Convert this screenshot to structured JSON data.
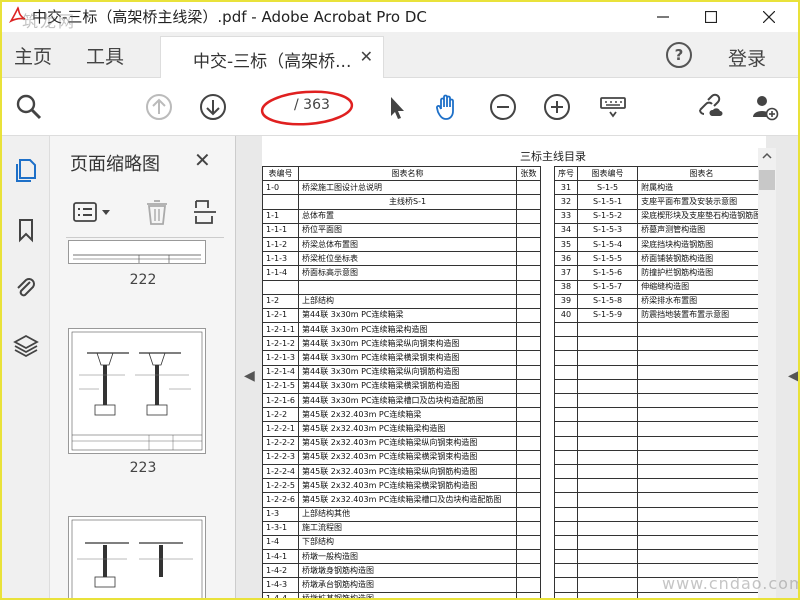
{
  "window": {
    "title": "中交-三标（高架桥主线梁）.pdf - Adobe Acrobat Pro DC",
    "watermark_top": "筑龙网",
    "watermark_bottom": "www.cndao.com",
    "accent_color": "#e9e23a"
  },
  "tabs": {
    "home": "主页",
    "tools": "工具",
    "document": "中交-三标（高架桥...",
    "login": "登录"
  },
  "toolbar": {
    "page_current": "",
    "page_total": "/ 363"
  },
  "thumbnails": {
    "panel_title": "页面缩略图",
    "pages": [
      "222",
      "223"
    ]
  },
  "document": {
    "heading": "三标主线目录",
    "left_table": {
      "headers": [
        "表编号",
        "图表名称",
        "张数"
      ],
      "rows": [
        [
          "1-0",
          "桥梁施工图设计总说明",
          ""
        ],
        [
          "",
          "主线桥S-1",
          ""
        ],
        [
          "1-1",
          "总体布置",
          ""
        ],
        [
          "1-1-1",
          "桥位平面图",
          ""
        ],
        [
          "1-1-2",
          "桥梁总体布置图",
          ""
        ],
        [
          "1-1-3",
          "桥梁桩位坐标表",
          ""
        ],
        [
          "1-1-4",
          "桥面标高示意图",
          ""
        ],
        [
          "",
          "",
          ""
        ],
        [
          "1-2",
          "上部结构",
          ""
        ],
        [
          "1-2-1",
          "第44联 3x30m PC连续箱梁",
          ""
        ],
        [
          "1-2-1-1",
          "第44联 3x30m PC连续箱梁构造图",
          ""
        ],
        [
          "1-2-1-2",
          "第44联 3x30m PC连续箱梁纵向钢束构造图",
          ""
        ],
        [
          "1-2-1-3",
          "第44联 3x30m PC连续箱梁横梁钢束构造图",
          ""
        ],
        [
          "1-2-1-4",
          "第44联 3x30m PC连续箱梁纵向钢筋构造图",
          ""
        ],
        [
          "1-2-1-5",
          "第44联 3x30m PC连续箱梁横梁钢筋构造图",
          ""
        ],
        [
          "1-2-1-6",
          "第44联 3x30m PC连续箱梁槽口及齿块构造配筋图",
          ""
        ],
        [
          "1-2-2",
          "第45联 2x32.403m PC连续箱梁",
          ""
        ],
        [
          "1-2-2-1",
          "第45联 2x32.403m PC连续箱梁构造图",
          ""
        ],
        [
          "1-2-2-2",
          "第45联 2x32.403m PC连续箱梁纵向钢束构造图",
          ""
        ],
        [
          "1-2-2-3",
          "第45联 2x32.403m PC连续箱梁横梁钢束构造图",
          ""
        ],
        [
          "1-2-2-4",
          "第45联 2x32.403m PC连续箱梁纵向钢筋构造图",
          ""
        ],
        [
          "1-2-2-5",
          "第45联 2x32.403m PC连续箱梁横梁钢筋构造图",
          ""
        ],
        [
          "1-2-2-6",
          "第45联 2x32.403m PC连续箱梁槽口及齿块构造配筋图",
          ""
        ],
        [
          "1-3",
          "上部结构其他",
          ""
        ],
        [
          "1-3-1",
          "施工流程图",
          ""
        ],
        [
          "1-4",
          "下部结构",
          ""
        ],
        [
          "1-4-1",
          "桥墩一般构造图",
          ""
        ],
        [
          "1-4-2",
          "桥墩墩身钢筋构造图",
          ""
        ],
        [
          "1-4-3",
          "桥墩承台钢筋构造图",
          ""
        ],
        [
          "1-4-4",
          "桥墩桩基钢筋构造图",
          ""
        ]
      ]
    },
    "right_table": {
      "headers": [
        "序号",
        "图表编号",
        "图表名"
      ],
      "rows": [
        [
          "31",
          "S-1-5",
          "附属构造"
        ],
        [
          "32",
          "S-1-5-1",
          "支座平面布置及安装示意图"
        ],
        [
          "33",
          "S-1-5-2",
          "梁底楔形块及支座垫石构造钢筋图"
        ],
        [
          "34",
          "S-1-5-3",
          "桥墓声测管构造图"
        ],
        [
          "35",
          "S-1-5-4",
          "梁底挡块构造钢筋图"
        ],
        [
          "36",
          "S-1-5-5",
          "桥面铺装钢筋构造图"
        ],
        [
          "37",
          "S-1-5-6",
          "防撞护栏钢筋构造图"
        ],
        [
          "38",
          "S-1-5-7",
          "伸缩缝构造图"
        ],
        [
          "39",
          "S-1-5-8",
          "桥梁排水布置图"
        ],
        [
          "40",
          "S-1-5-9",
          "防震挡地装置布置示意图"
        ]
      ]
    }
  }
}
